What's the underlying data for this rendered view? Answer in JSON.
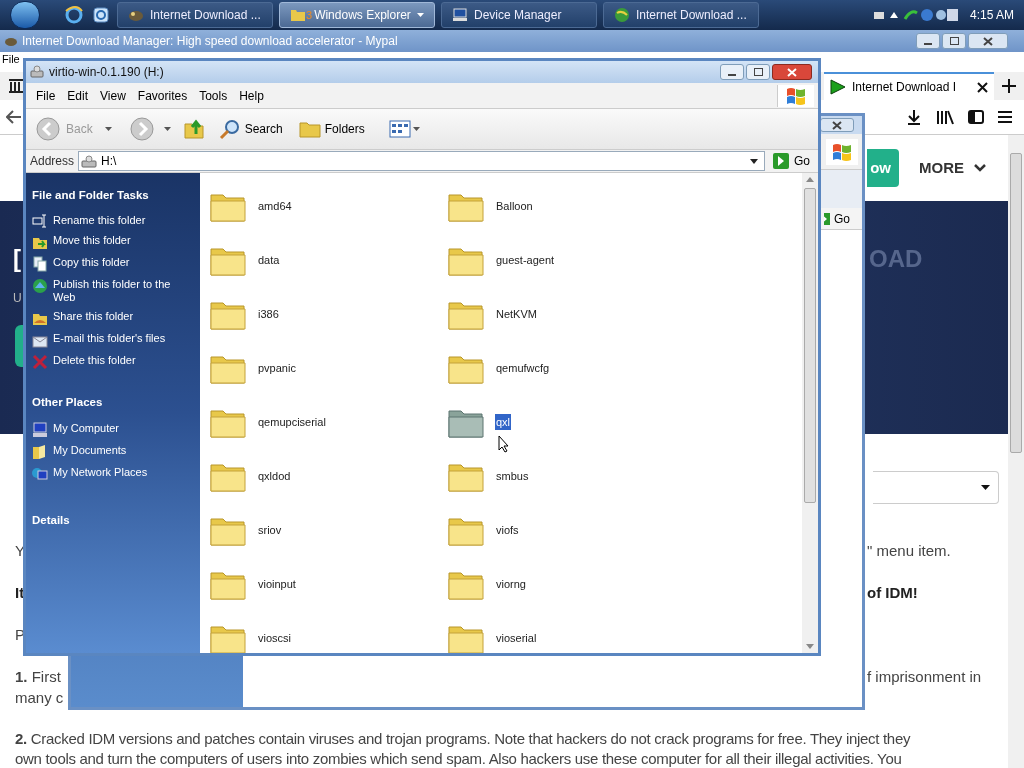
{
  "taskbar": {
    "buttons": [
      {
        "label": "Internet Download ...",
        "selected": false,
        "kind": "idm"
      },
      {
        "label": "Windows Explorer",
        "count": "3",
        "selected": true,
        "kind": "folder"
      },
      {
        "label": "Device Manager",
        "selected": false,
        "kind": "device"
      },
      {
        "label": "Internet Download ...",
        "selected": false,
        "kind": "globe"
      }
    ],
    "clock": "4:15 AM"
  },
  "browser": {
    "title": "Internet Download Manager: High speed download accelerator - Mypal",
    "menu": [
      "File"
    ],
    "tab": {
      "label": "Internet Download I"
    },
    "page": {
      "nav_button": "ow",
      "more": "MORE",
      "hero_heading": "[",
      "hero_sub": "U",
      "hero_faded": "OAD",
      "lines": [
        {
          "left": "Y",
          "right": "\" menu item.",
          "bold": false
        },
        {
          "left": "It",
          "right": "of IDM!",
          "bold": true
        },
        {
          "left": "P",
          "bold": false
        },
        {
          "left": "**1.** First",
          "right": "f imprisonment in",
          "bold": false
        },
        {
          "left": "many c",
          "bold": false
        }
      ],
      "paragraph": [
        "**2.** Cracked IDM versions and patches contain viruses and trojan programs. Note that hackers do not crack programs for free. They inject they",
        "own tools and turn the computers of users into zombies which send spam. Also hackers use these computer for all their illegal activities. You"
      ]
    }
  },
  "back_window": {
    "go": "Go"
  },
  "explorer": {
    "title": "virtio-win-0.1.190 (H:)",
    "menu": [
      "File",
      "Edit",
      "View",
      "Favorites",
      "Tools",
      "Help"
    ],
    "toolbar": {
      "back": {
        "label": "Back",
        "disabled": true
      },
      "search": "Search",
      "folders": "Folders"
    },
    "address": {
      "label": "Address",
      "value": "H:\\",
      "go": "Go"
    },
    "tasks": {
      "title": "File and Folder Tasks",
      "items": [
        "Rename this folder",
        "Move this folder",
        "Copy this folder",
        "Publish this folder to the Web",
        "Share this folder",
        "E-mail this folder's files",
        "Delete this folder"
      ]
    },
    "other_places": {
      "title": "Other Places",
      "items": [
        "My Computer",
        "My Documents",
        "My Network Places"
      ]
    },
    "details": {
      "title": "Details"
    },
    "folders": [
      {
        "name": "amd64",
        "selected": false
      },
      {
        "name": "Balloon",
        "selected": false
      },
      {
        "name": "data",
        "selected": false
      },
      {
        "name": "guest-agent",
        "selected": false
      },
      {
        "name": "i386",
        "selected": false
      },
      {
        "name": "NetKVM",
        "selected": false
      },
      {
        "name": "pvpanic",
        "selected": false
      },
      {
        "name": "qemufwcfg",
        "selected": false
      },
      {
        "name": "qemupciserial",
        "selected": false
      },
      {
        "name": "qxl",
        "selected": true
      },
      {
        "name": "qxldod",
        "selected": false
      },
      {
        "name": "smbus",
        "selected": false
      },
      {
        "name": "sriov",
        "selected": false
      },
      {
        "name": "viofs",
        "selected": false
      },
      {
        "name": "vioinput",
        "selected": false
      },
      {
        "name": "viorng",
        "selected": false
      },
      {
        "name": "vioscsi",
        "selected": false
      },
      {
        "name": "vioserial",
        "selected": false
      }
    ]
  }
}
